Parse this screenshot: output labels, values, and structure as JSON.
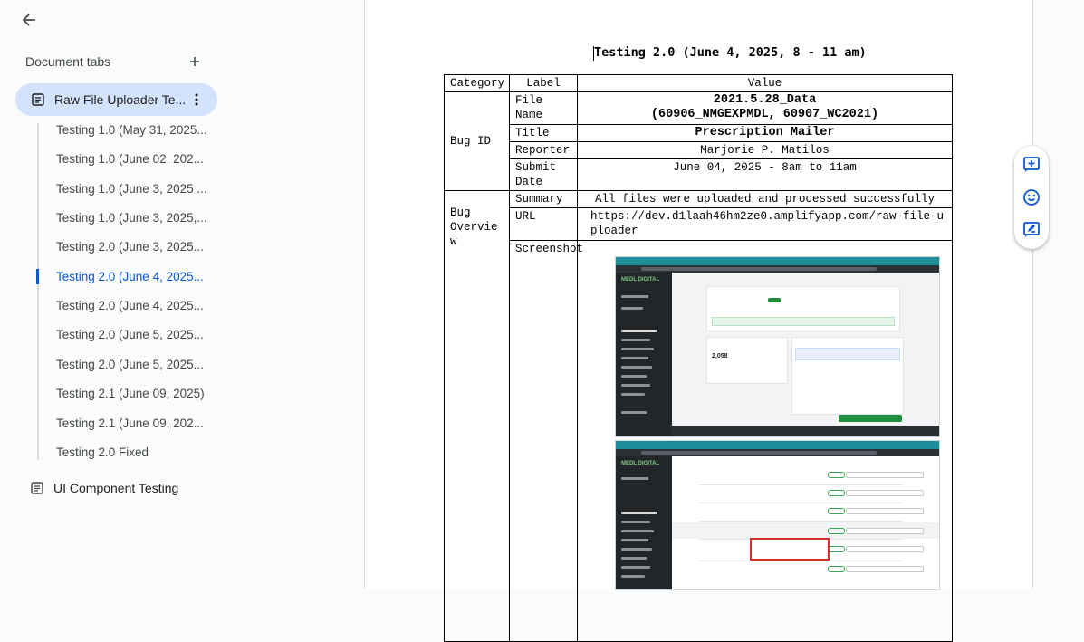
{
  "sidebar": {
    "header": "Document tabs",
    "main_tab": "Raw File Uploader Te...",
    "subtabs": [
      "Testing 1.0 (May 31, 2025...",
      "Testing 1.0 (June 02, 202...",
      "Testing 1.0 (June 3, 2025 ...",
      "Testing 1.0 (June 3, 2025,...",
      "Testing 2.0 (June 3, 2025...",
      "Testing 2.0 (June 4, 2025...",
      "Testing 2.0 (June 4, 2025...",
      "Testing 2.0 (June 5, 2025...",
      "Testing 2.0 (June 5, 2025...",
      "Testing 2.1 (June 09, 2025)",
      "Testing 2.1 (June 09, 202...",
      "Testing 2.0 Fixed"
    ],
    "active_subtab_index": 5,
    "second_doc": "UI Component Testing"
  },
  "document": {
    "title": "Testing 2.0 (June 4, 2025, 8 - 11 am)",
    "table": {
      "headers": [
        "Category",
        "Label",
        "Value"
      ],
      "bug_id_category": "Bug ID",
      "bug_overview_category": "Bug\nOvervie\nw",
      "file_name_label": "File Name",
      "file_name_value": "2021.5.28_Data\n(60906_NMGEXPMDL, 60907_WC2021)",
      "title_label": "Title",
      "title_value": "Prescription Mailer",
      "reporter_label": "Reporter",
      "reporter_value": "Marjorie P. Matilos",
      "submit_date_label": "Submit Date",
      "submit_date_value": "June 04, 2025 - 8am to 11am",
      "summary_label": "Summary",
      "summary_value": "All files were uploaded and processed successfully",
      "url_label": "URL",
      "url_value": "https://dev.d1laah46hm2ze0.amplifyapp.com/raw-file-uploader",
      "screenshot_label": "Screenshot"
    },
    "screenshot1": {
      "logo": "MEDL DIGITAL",
      "big_number": "2,058"
    }
  },
  "colors": {
    "accent": "#0b57d0",
    "active_tab_bg": "#d3e3fd",
    "sidebar_bg": "#f9fbfd"
  }
}
